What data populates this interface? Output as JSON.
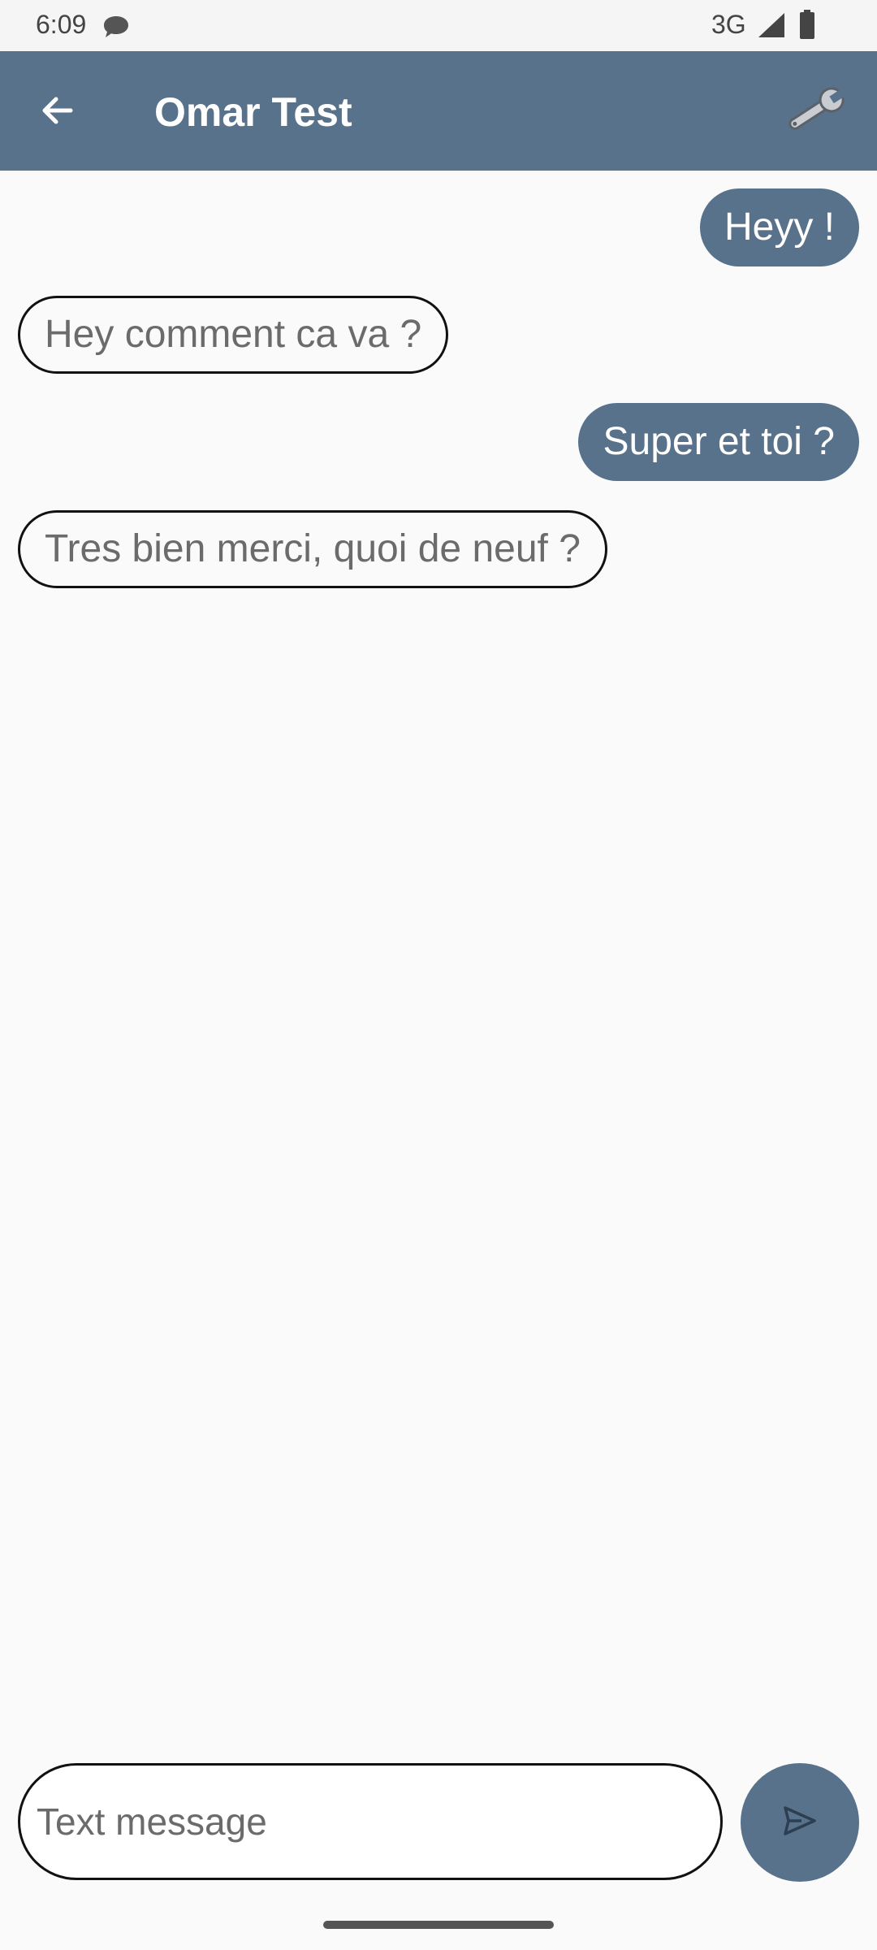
{
  "status_bar": {
    "time": "6:09",
    "network": "3G",
    "icons": [
      "message-icon",
      "signal-icon",
      "battery-icon"
    ]
  },
  "app_bar": {
    "title": "Omar Test",
    "back_icon": "arrow-back-icon",
    "settings_icon": "wrench-icon"
  },
  "messages": [
    {
      "text": "Heyy !",
      "direction": "outgoing"
    },
    {
      "text": "Hey comment ca va ?",
      "direction": "incoming"
    },
    {
      "text": "Super et toi ?",
      "direction": "outgoing"
    },
    {
      "text": "Tres bien merci, quoi de neuf ?",
      "direction": "incoming"
    }
  ],
  "composer": {
    "placeholder": "Text message",
    "value": "",
    "send_icon": "send-icon"
  },
  "colors": {
    "accent": "#58728c",
    "background": "#fafafa",
    "incoming_text": "#6b6b6b",
    "outgoing_text": "#ffffff"
  }
}
